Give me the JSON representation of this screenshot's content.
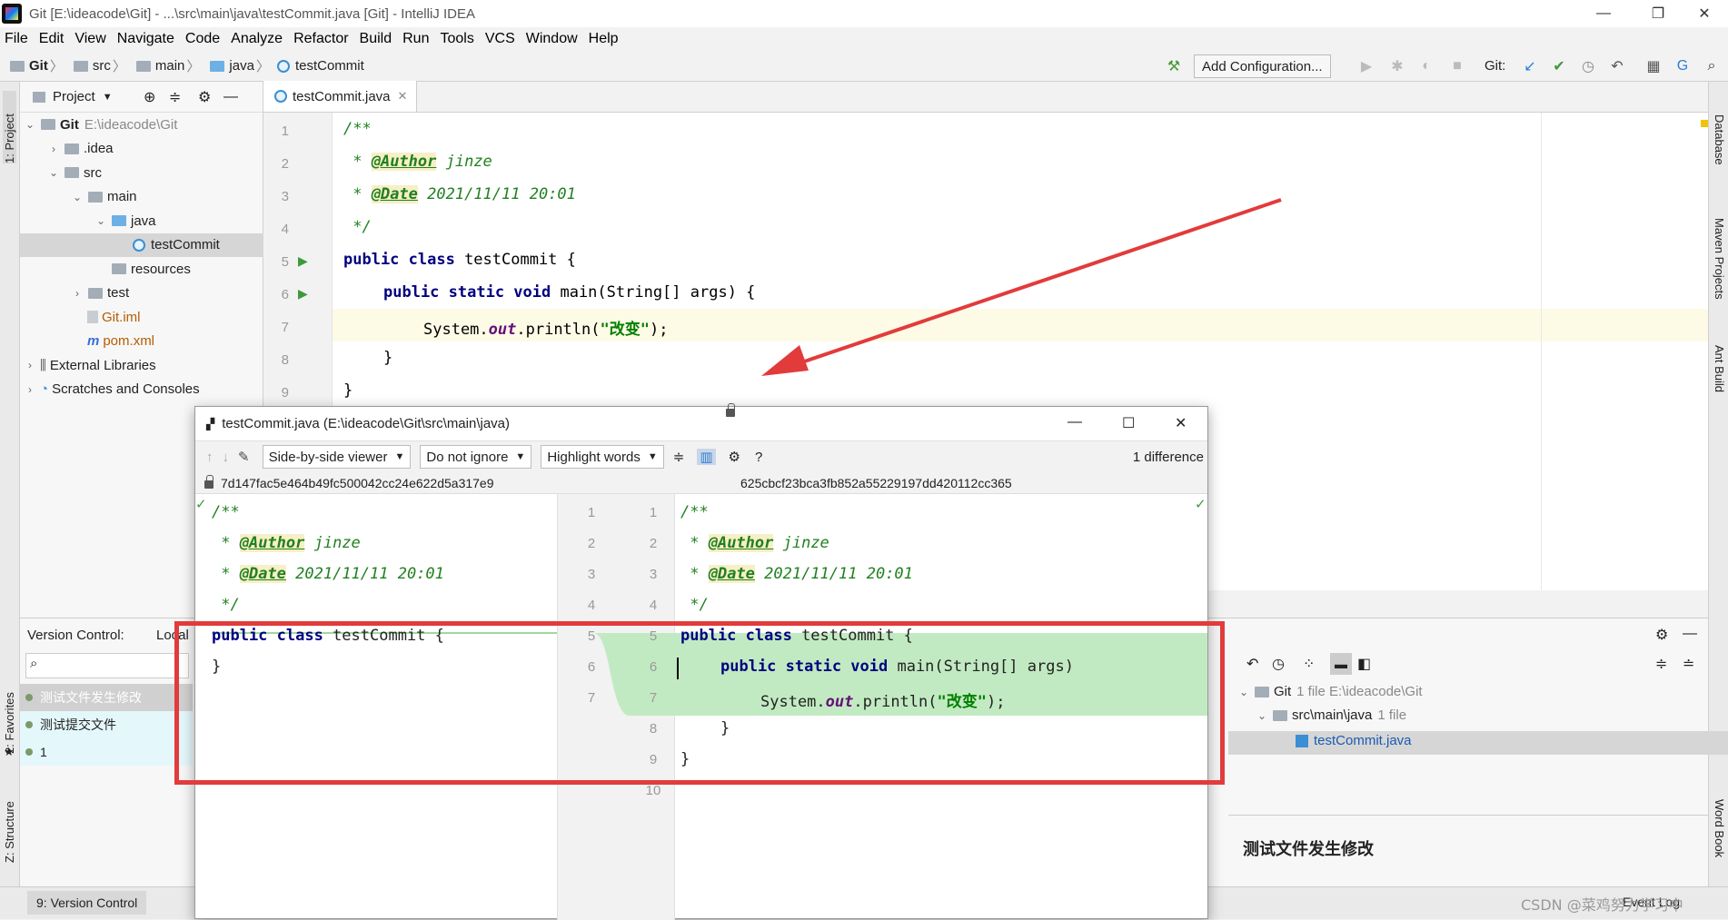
{
  "window": {
    "title": "Git [E:\\ideacode\\Git] - ...\\src\\main\\java\\testCommit.java [Git] - IntelliJ IDEA"
  },
  "menu": [
    "File",
    "Edit",
    "View",
    "Navigate",
    "Code",
    "Analyze",
    "Refactor",
    "Build",
    "Run",
    "Tools",
    "VCS",
    "Window",
    "Help"
  ],
  "breadcrumbs": [
    "Git",
    "src",
    "main",
    "java",
    "testCommit"
  ],
  "toolbar": {
    "run_config": "Add Configuration...",
    "git_label": "Git:"
  },
  "project": {
    "header": "Project",
    "tree": [
      {
        "label": "Git",
        "extra": "E:\\ideacode\\Git",
        "indent": 0,
        "kind": "root"
      },
      {
        "label": ".idea",
        "indent": 1,
        "kind": "folder"
      },
      {
        "label": "src",
        "indent": 1,
        "kind": "folder"
      },
      {
        "label": "main",
        "indent": 2,
        "kind": "folder"
      },
      {
        "label": "java",
        "indent": 3,
        "kind": "folder-blue"
      },
      {
        "label": "testCommit",
        "indent": 4,
        "kind": "class"
      },
      {
        "label": "resources",
        "indent": 3,
        "kind": "folder"
      },
      {
        "label": "test",
        "indent": 2,
        "kind": "folder"
      },
      {
        "label": "Git.iml",
        "indent": 2,
        "kind": "file-orange"
      },
      {
        "label": "pom.xml",
        "indent": 2,
        "kind": "maven"
      },
      {
        "label": "External Libraries",
        "indent": 0,
        "kind": "lib"
      },
      {
        "label": "Scratches and Consoles",
        "indent": 0,
        "kind": "scratch"
      }
    ]
  },
  "editor": {
    "tab": "testCommit.java",
    "line_numbers": [
      "1",
      "2",
      "3",
      "4",
      "5",
      "6",
      "7",
      "8",
      "9"
    ],
    "lines": {
      "l1": "/**",
      "l2_star": " * ",
      "l2_tag": "@Author",
      "l2_text": " jinze",
      "l3_star": " * ",
      "l3_tag": "@Date",
      "l3_text": " 2021/11/11 20:01",
      "l4": " */",
      "l5_kw": "public class",
      "l5_text": " testCommit {",
      "l6_kw": "public static void",
      "l6_text": " main(String[] args) {",
      "l7_a": "System.",
      "l7_fld": "out",
      "l7_b": ".println(",
      "l7_str": "\"改变\"",
      "l7_c": ");",
      "l8": "}",
      "l9": "}"
    }
  },
  "vc": {
    "label": "Version Control:",
    "local": "Local",
    "commits": [
      "测试文件发生修改",
      "测试提交文件",
      "1"
    ],
    "changes": {
      "root": "Git",
      "root_meta": "1 file  E:\\ideacode\\Git",
      "dir": "src\\main\\java",
      "dir_meta": "1 file",
      "file": "testCommit.java"
    },
    "commit_message": "测试文件发生修改"
  },
  "diff": {
    "title": "testCommit.java (E:\\ideacode\\Git\\src\\main\\java)",
    "viewer": "Side-by-side viewer",
    "ignore": "Do not ignore",
    "highlight": "Highlight words",
    "diff_count": "1 difference",
    "left_hash": "7d147fac5e464b49fc500042cc24e622d5a317e9",
    "right_hash": "625cbcf23bca3fb852a55229197dd420112cc365",
    "left_line_numbers": [
      "1",
      "2",
      "3",
      "4",
      "5",
      "6",
      "7"
    ],
    "right_line_numbers": [
      "1",
      "2",
      "3",
      "4",
      "5",
      "6",
      "7",
      "8",
      "9",
      "10"
    ],
    "left": {
      "l1": "/**",
      "l2_star": " * ",
      "l2_tag": "@Author",
      "l2_text": " jinze",
      "l3_star": " * ",
      "l3_tag": "@Date",
      "l3_text": " 2021/11/11 20:01",
      "l4": " */",
      "l5_kw": "public class",
      "l5_text": " testCommit {",
      "l6": "}"
    },
    "right": {
      "l1": "/**",
      "l2_star": " * ",
      "l2_tag": "@Author",
      "l2_text": " jinze",
      "l3_star": " * ",
      "l3_tag": "@Date",
      "l3_text": " 2021/11/11 20:01",
      "l4": " */",
      "l5_kw": "public class",
      "l5_text": " testCommit {",
      "l6_kw": "public static void",
      "l6_text": " main(String[] args)",
      "l7_a": "System.",
      "l7_fld": "out",
      "l7_b": ".println(",
      "l7_str": "\"改变\"",
      "l7_c": ");",
      "l8": "}",
      "l9": "}"
    }
  },
  "side_tools": {
    "left": [
      "1: Project",
      "2: Favorites",
      "Z: Structure"
    ],
    "right": [
      "Database",
      "Maven Projects",
      "Ant Build",
      "Word Book"
    ]
  },
  "bottom": {
    "version_control": "9: Version Control",
    "event_log": "Event Log"
  },
  "watermark": "CSDN @菜鸡努力学习中"
}
